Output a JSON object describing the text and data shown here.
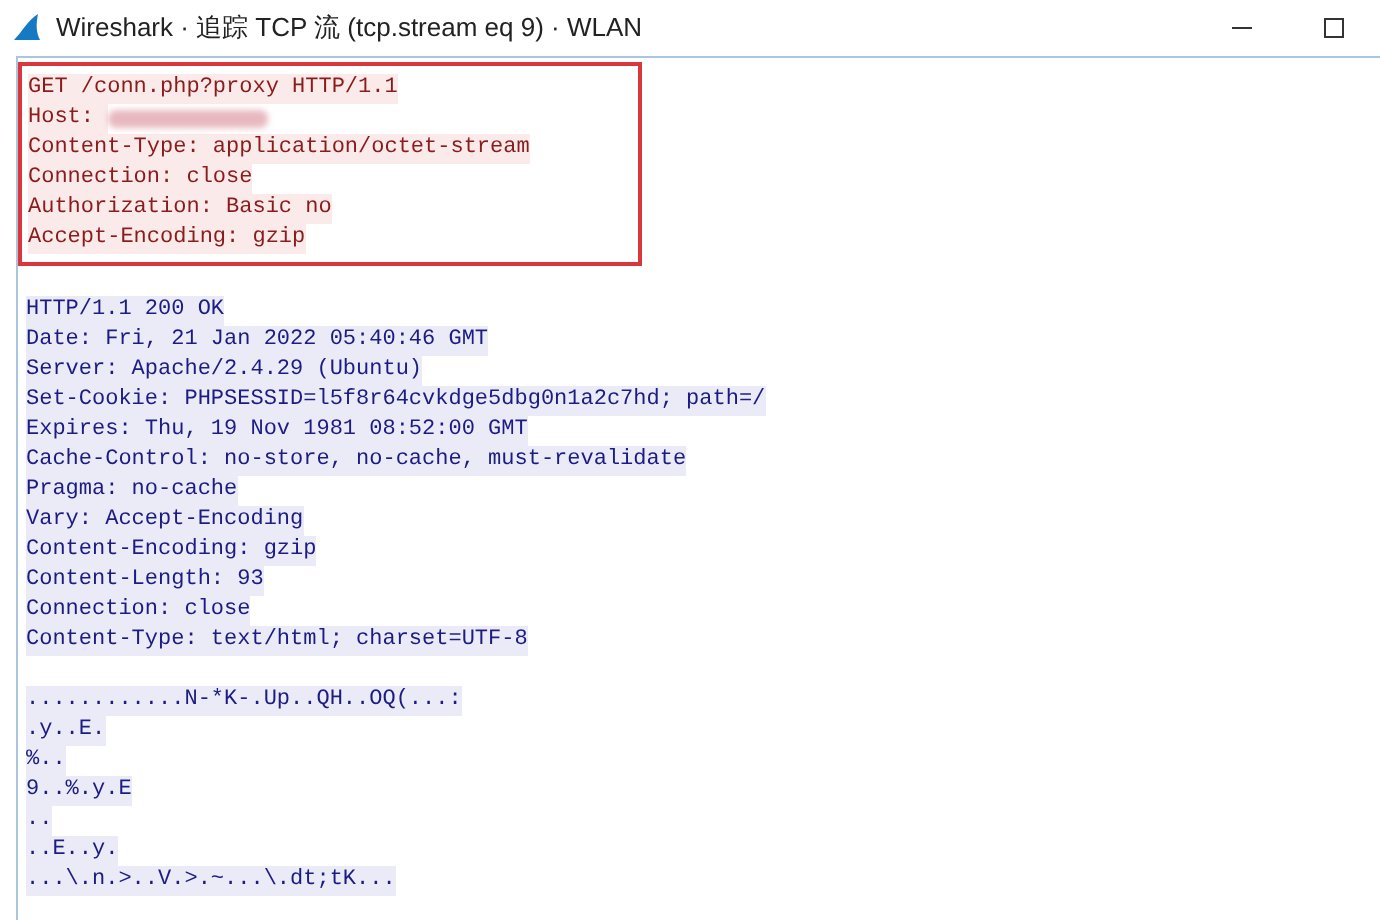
{
  "window": {
    "title": "Wireshark · 追踪 TCP 流 (tcp.stream eq 9) · WLAN"
  },
  "stream": [
    {
      "kind": "client",
      "highlighted": true,
      "lines": [
        {
          "text": "GET /conn.php?proxy HTTP/1.1",
          "redacted": false
        },
        {
          "text": "Host: ",
          "redacted": true
        },
        {
          "text": "Content-Type: application/octet-stream",
          "redacted": false
        },
        {
          "text": "Connection: close",
          "redacted": false
        },
        {
          "text": "Authorization: Basic no",
          "redacted": false
        },
        {
          "text": "Accept-Encoding: gzip",
          "redacted": false
        }
      ]
    },
    {
      "kind": "server",
      "highlighted": false,
      "lines": [
        {
          "text": "HTTP/1.1 200 OK",
          "redacted": false
        },
        {
          "text": "Date: Fri, 21 Jan 2022 05:40:46 GMT",
          "redacted": false
        },
        {
          "text": "Server: Apache/2.4.29 (Ubuntu)",
          "redacted": false
        },
        {
          "text": "Set-Cookie: PHPSESSID=l5f8r64cvkdge5dbg0n1a2c7hd; path=/",
          "redacted": false
        },
        {
          "text": "Expires: Thu, 19 Nov 1981 08:52:00 GMT",
          "redacted": false
        },
        {
          "text": "Cache-Control: no-store, no-cache, must-revalidate",
          "redacted": false
        },
        {
          "text": "Pragma: no-cache",
          "redacted": false
        },
        {
          "text": "Vary: Accept-Encoding",
          "redacted": false
        },
        {
          "text": "Content-Encoding: gzip",
          "redacted": false
        },
        {
          "text": "Content-Length: 93",
          "redacted": false
        },
        {
          "text": "Connection: close",
          "redacted": false
        },
        {
          "text": "Content-Type: text/html; charset=UTF-8",
          "redacted": false
        }
      ]
    },
    {
      "kind": "server",
      "highlighted": false,
      "lines": [
        {
          "text": "............N-*K-.Up..QH..OQ(...:",
          "redacted": false
        },
        {
          "text": ".y..E.",
          "redacted": false
        },
        {
          "text": "%..",
          "redacted": false
        },
        {
          "text": "9..%.y.E",
          "redacted": false
        },
        {
          "text": "..",
          "redacted": false
        },
        {
          "text": "..E..y.",
          "redacted": false
        },
        {
          "text": "...\\.n.>..V.>.~...\\.dt;tK...",
          "redacted": false
        }
      ]
    }
  ]
}
